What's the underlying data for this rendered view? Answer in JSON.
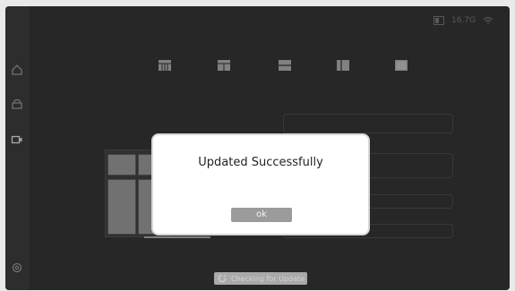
{
  "status": {
    "storage": "16.7G",
    "storage_icon": "storage-icon",
    "wifi_icon": "wifi-icon"
  },
  "sidebar": {
    "items": [
      "home-icon",
      "lock-icon",
      "camera-icon",
      "settings-icon"
    ]
  },
  "layout_options": [
    "grid-icon",
    "split-icon",
    "stack-icon",
    "columns-icon",
    "single-icon"
  ],
  "dialog": {
    "title": "Updated Successfully",
    "ok_label": "ok"
  },
  "update": {
    "label": "Checking for Update",
    "icon": "refresh-icon"
  }
}
